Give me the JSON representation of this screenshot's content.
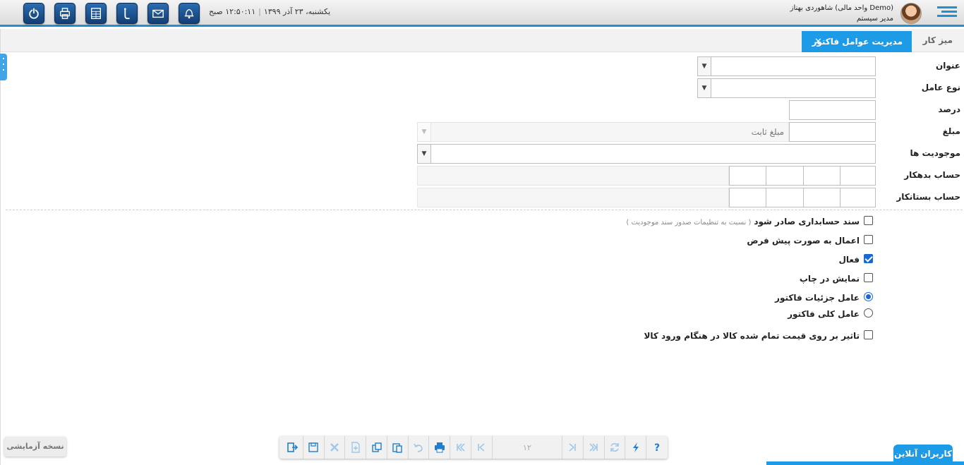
{
  "header": {
    "user_name": "شاهوردی بهناز (واحد مالی Demo)",
    "user_role": "مدیر سیستم",
    "date": "یکشنبه، ۲۳ آذر ۱۳۹۹",
    "time": "۱۲:۵۰:۱۱ صبح",
    "icons": [
      "power-icon",
      "printer-icon",
      "calculator-icon",
      "phone-icon",
      "mail-icon",
      "bell-icon"
    ]
  },
  "tabs": {
    "desk": "میز کار",
    "active": "مدیریت عوامل فاکتور"
  },
  "form": {
    "title_label": "عنوان",
    "type_label": "نوع عامل",
    "percent_label": "درصد",
    "amount_label": "مبلغ",
    "amount_select_value": "مبلغ ثابت",
    "entities_label": "موجودیت ها",
    "debit_label": "حساب بدهکار",
    "credit_label": "حساب بستانکار"
  },
  "options": {
    "accounting_doc": "سند حسابداری صادر شود",
    "accounting_doc_hint": "( نسبت به تنظیمات صدور سند موجودیت )",
    "default_apply": "اعمال به صورت پیش فرض",
    "active": "فعال",
    "show_in_print": "نمایش در چاپ",
    "detail_factor": "عامل جزئیات فاکتور",
    "general_factor": "عامل کلی فاکتور",
    "cost_effect": "تاثیر بر روی قیمت تمام شده کالا در هنگام ورود کالا",
    "state": {
      "accounting_doc": false,
      "default_apply": false,
      "active": true,
      "show_in_print": false,
      "factor_scope": "detail",
      "cost_effect": false
    }
  },
  "footer": {
    "trial": "نسخه آزمایشی",
    "online_users": "کاربران آنلاین",
    "page_number": "۱۲"
  },
  "colors": {
    "accent": "#1e9be6",
    "header_icon": "#1a4f8f"
  }
}
